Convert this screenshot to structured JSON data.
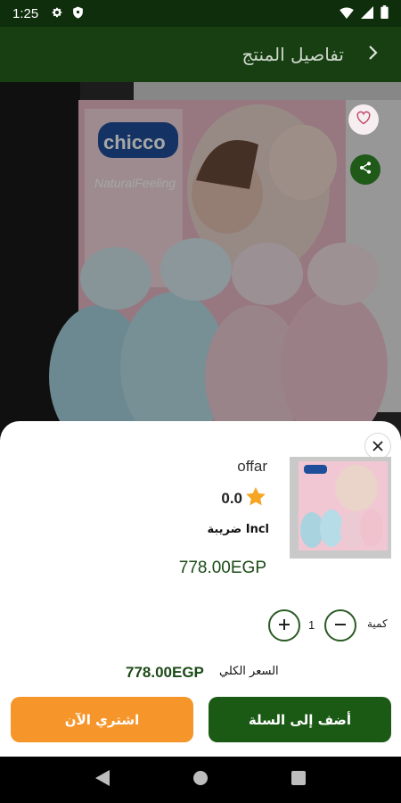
{
  "status_bar": {
    "time": "1:25",
    "left_icons": [
      "gear-icon",
      "shield-icon"
    ],
    "right_icons": [
      "wifi-icon",
      "signal-icon",
      "battery-icon"
    ]
  },
  "app_bar": {
    "title": "تفاصيل المنتج",
    "back_icon": "chevron-right-icon"
  },
  "hero": {
    "brand_logo": "chicco",
    "brand_tagline": "NaturalFeeling",
    "favorite_icon": "heart-outline-icon",
    "share_icon": "share-icon"
  },
  "sheet": {
    "seller": "offar",
    "rating": "0.0",
    "tax": "ضريبة Incl",
    "price": "778.00EGP",
    "quantity_label": "كمية",
    "quantity": "1",
    "total_label": "السعر الكلي",
    "total_value": "778.00EGP",
    "add_to_cart": "أضف إلى السلة",
    "buy_now": "اشتري الآن"
  },
  "colors": {
    "app_bar": "#173f12",
    "primary_green": "#1b5a14",
    "accent_orange": "#f6962a",
    "star": "#f5a623"
  }
}
